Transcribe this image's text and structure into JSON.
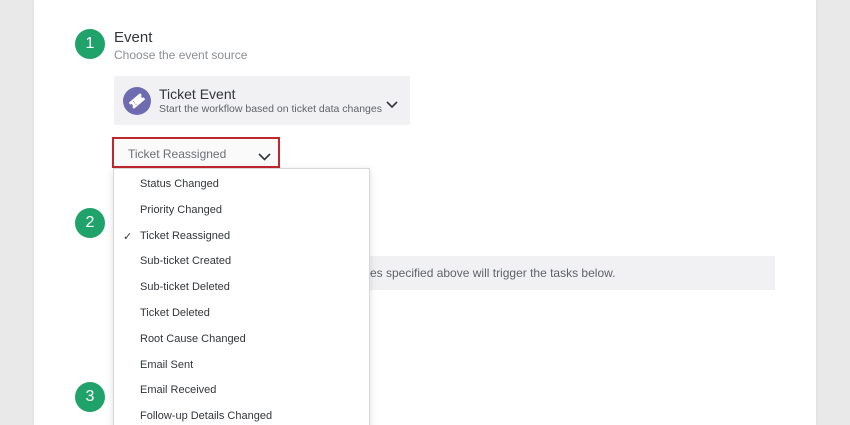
{
  "step1": {
    "number": "1",
    "title": "Event",
    "subtitle": "Choose the event source",
    "event_card": {
      "title": "Ticket Event",
      "description": "Start the workflow based on ticket data changes",
      "icon": "ticket-icon"
    },
    "select": {
      "value": "Ticket Reassigned",
      "icon": "chevron-down-icon"
    }
  },
  "step2": {
    "number": "2",
    "info_text": "es specified above will trigger the tasks below."
  },
  "step3": {
    "number": "3"
  },
  "dropdown": {
    "selected_index": 2,
    "options": [
      "Status Changed",
      "Priority Changed",
      "Ticket Reassigned",
      "Sub-ticket Created",
      "Sub-ticket Deleted",
      "Ticket Deleted",
      "Root Cause Changed",
      "Email Sent",
      "Email Received",
      "Follow-up Details Changed"
    ]
  },
  "colors": {
    "step_circle": "#1fa36a",
    "highlight_border": "#c0272d",
    "ticket_icon_bg": "#6f6bb0"
  }
}
